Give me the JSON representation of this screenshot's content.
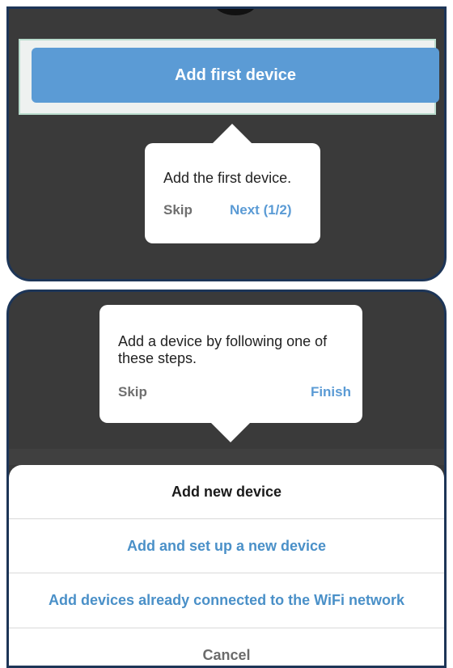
{
  "top_screen": {
    "primary_button_label": "Add first device",
    "tooltip": {
      "message": "Add the first device.",
      "skip_label": "Skip",
      "next_label": "Next (1/2)"
    }
  },
  "bottom_screen": {
    "tooltip": {
      "message": "Add a device by following one of these steps.",
      "skip_label": "Skip",
      "finish_label": "Finish"
    },
    "sheet": {
      "title": "Add new device",
      "options": [
        "Add and set up a new device",
        "Add devices already connected to the WiFi network"
      ],
      "cancel_label": "Cancel"
    }
  },
  "colors": {
    "accent": "#5b9bd5",
    "overlay": "#3a3a3a",
    "frame_border": "#1d3557"
  }
}
